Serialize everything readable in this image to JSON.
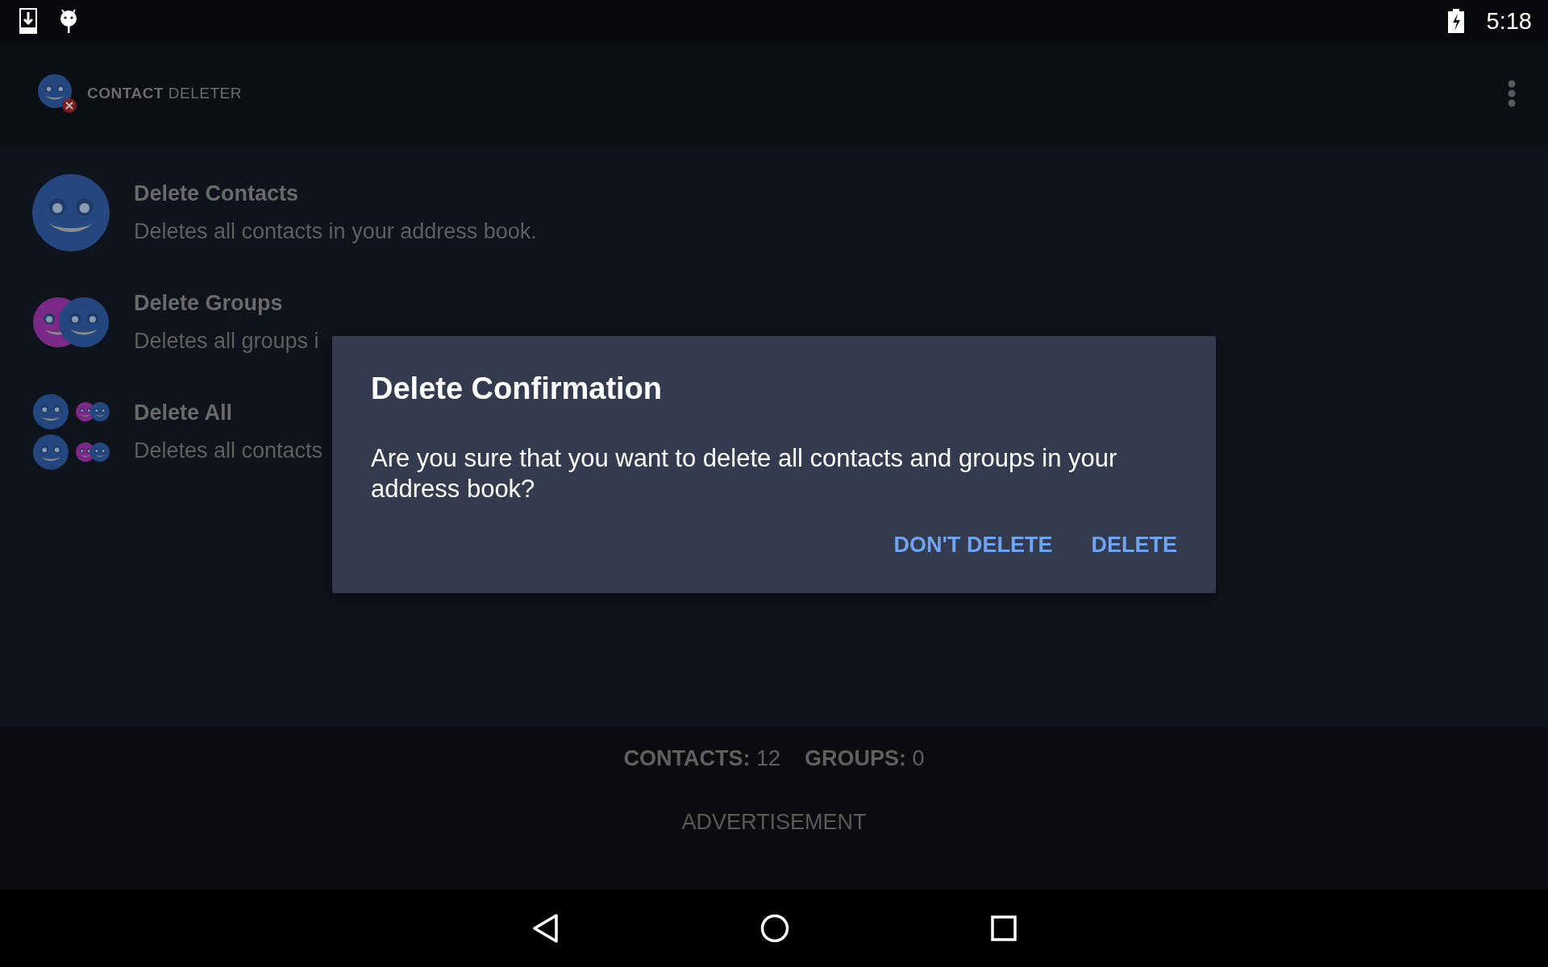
{
  "status_bar": {
    "time": "5:18"
  },
  "app_bar": {
    "logo_bold": "CONTACT",
    "logo_light": "DELETER"
  },
  "actions": [
    {
      "kind": "single",
      "title": "Delete Contacts",
      "description": "Deletes all contacts in your address book."
    },
    {
      "kind": "pair",
      "title": "Delete Groups",
      "description": "Deletes all groups i"
    },
    {
      "kind": "quad",
      "title": "Delete All",
      "description": "Deletes all contacts"
    }
  ],
  "stats": [
    {
      "label": "CONTACTS:",
      "value": "12"
    },
    {
      "label": "GROUPS:",
      "value": "0"
    }
  ],
  "advertisement": "ADVERTISEMENT",
  "dialog": {
    "title": "Delete Confirmation",
    "message": "Are you sure that you want to delete all contacts and groups in your address book?",
    "buttons": [
      "DON'T DELETE",
      "DELETE"
    ]
  }
}
